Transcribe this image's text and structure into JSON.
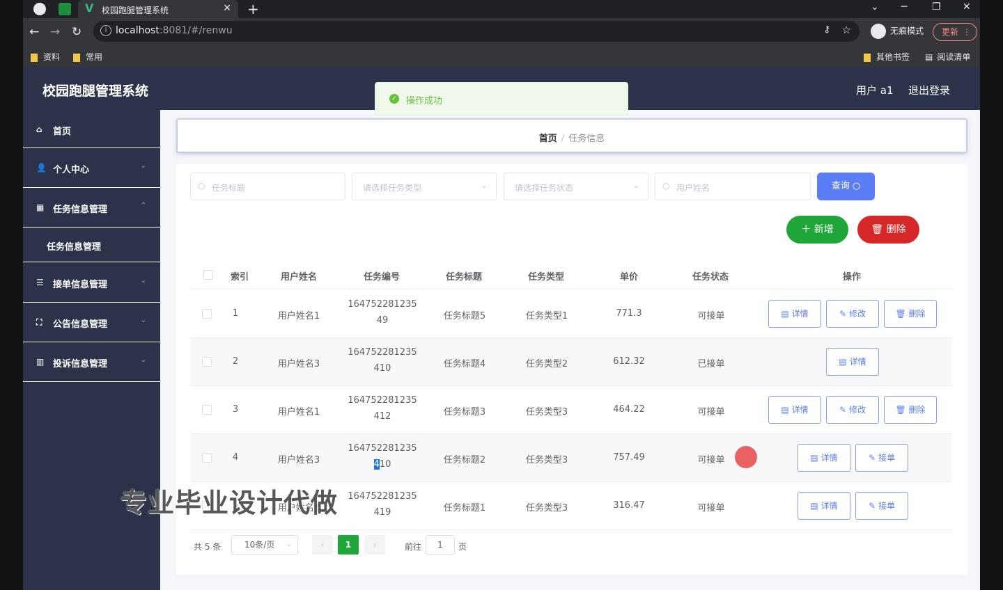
{
  "browser": {
    "tab_title": "校园跑腿管理系统",
    "url_host": "localhost",
    "url_path": ":8081/#/renwu",
    "incognito_label": "无痕模式",
    "update_label": "更新",
    "bookmarks": [
      "资料",
      "常用"
    ],
    "bookmarks_right": [
      "其他书签",
      "阅读清单"
    ]
  },
  "app": {
    "brand": "校园跑腿管理系统",
    "user_label": "用户 a1",
    "logout_label": "退出登录"
  },
  "sidebar": {
    "items": [
      {
        "label": "首页",
        "icon": "home-icon"
      },
      {
        "label": "个人中心",
        "icon": "user-icon"
      },
      {
        "label": "任务信息管理",
        "icon": "grid-icon"
      },
      {
        "label": "任务信息管理",
        "icon": ""
      },
      {
        "label": "接单信息管理",
        "icon": "list-icon"
      },
      {
        "label": "公告信息管理",
        "icon": "frame-icon"
      },
      {
        "label": "投诉信息管理",
        "icon": "chart-icon"
      }
    ]
  },
  "breadcrumb": {
    "home": "首页",
    "separator": "/",
    "current": "任务信息"
  },
  "toast": {
    "message": "操作成功"
  },
  "search": {
    "title_placeholder": "任务标题",
    "type_placeholder": "请选择任务类型",
    "status_placeholder": "请选择任务状态",
    "user_placeholder": "用户姓名",
    "query_label": "查询"
  },
  "actions": {
    "add_label": "新增",
    "delete_label": "删除"
  },
  "table": {
    "headers": [
      "索引",
      "用户姓名",
      "任务编号",
      "任务标题",
      "任务类型",
      "单价",
      "任务状态",
      "操作"
    ],
    "rows": [
      {
        "index": "1",
        "user": "用户姓名1",
        "no_line1": "164752281235",
        "no_line2": "49",
        "title": "任务标题5",
        "type": "任务类型1",
        "price": "771.3",
        "status": "可接单",
        "ops": [
          "详情",
          "修改",
          "删除"
        ]
      },
      {
        "index": "2",
        "user": "用户姓名3",
        "no_line1": "164752281235",
        "no_line2": "410",
        "title": "任务标题4",
        "type": "任务类型2",
        "price": "612.32",
        "status": "已接单",
        "ops": [
          "详情"
        ]
      },
      {
        "index": "3",
        "user": "用户姓名1",
        "no_line1": "164752281235",
        "no_line2": "412",
        "title": "任务标题3",
        "type": "任务类型3",
        "price": "464.22",
        "status": "可接单",
        "ops": [
          "详情",
          "修改",
          "删除"
        ]
      },
      {
        "index": "4",
        "user": "用户姓名3",
        "no_line1": "164752281235",
        "no_line2": "410",
        "title": "任务标题2",
        "type": "任务类型3",
        "price": "757.49",
        "status": "可接单",
        "ops": [
          "详情",
          "接单"
        ]
      },
      {
        "index": "5",
        "user": "用户姓名2",
        "no_line1": "164752281235",
        "no_line2": "419",
        "title": "任务标题1",
        "type": "任务类型3",
        "price": "316.47",
        "status": "可接单",
        "ops": [
          "详情",
          "接单"
        ]
      }
    ]
  },
  "pagination": {
    "total": "共 5 条",
    "page_size": "10条/页",
    "current_page": "1",
    "goto_label": "前往",
    "goto_value": "1",
    "unit": "页"
  },
  "watermark": "专业毕业设计代做"
}
